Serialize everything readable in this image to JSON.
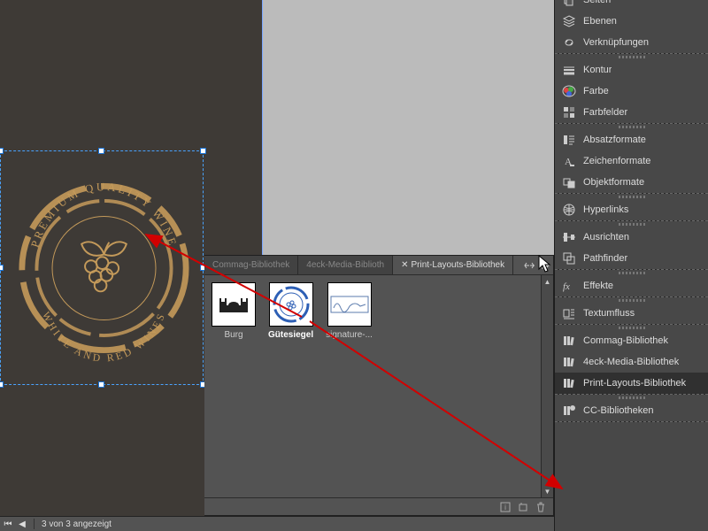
{
  "seal": {
    "top_text": "PREMIUM QUALITY WINE",
    "bottom_text": "WHITE AND RED WINES"
  },
  "library_panel": {
    "tabs": [
      {
        "label": "Commag-Bibliothek",
        "active": false
      },
      {
        "label": "4eck-Media-Biblioth",
        "active": false
      },
      {
        "label": "Print-Layouts-Bibliothek",
        "active": true
      }
    ],
    "items": [
      {
        "label": "Burg"
      },
      {
        "label": "Gütesiegel"
      },
      {
        "label": "signature-..."
      }
    ]
  },
  "status_bar": {
    "page_info": "3 von 3 angezeigt"
  },
  "dock": {
    "groups": [
      {
        "items": [
          {
            "icon": "pages",
            "label": "Seiten"
          },
          {
            "icon": "layers",
            "label": "Ebenen"
          },
          {
            "icon": "links",
            "label": "Verknüpfungen"
          }
        ]
      },
      {
        "items": [
          {
            "icon": "stroke",
            "label": "Kontur"
          },
          {
            "icon": "color",
            "label": "Farbe"
          },
          {
            "icon": "swatch",
            "label": "Farbfelder"
          }
        ]
      },
      {
        "items": [
          {
            "icon": "parastyle",
            "label": "Absatzformate"
          },
          {
            "icon": "charstyle",
            "label": "Zeichenformate"
          },
          {
            "icon": "objstyle",
            "label": "Objektformate"
          }
        ]
      },
      {
        "items": [
          {
            "icon": "hyperlink",
            "label": "Hyperlinks"
          }
        ]
      },
      {
        "items": [
          {
            "icon": "align",
            "label": "Ausrichten"
          },
          {
            "icon": "pathfinder",
            "label": "Pathfinder"
          }
        ]
      },
      {
        "items": [
          {
            "icon": "fx",
            "label": "Effekte"
          }
        ]
      },
      {
        "items": [
          {
            "icon": "textwrap",
            "label": "Textumfluss"
          }
        ]
      },
      {
        "items": [
          {
            "icon": "lib",
            "label": "Commag-Bibliothek"
          },
          {
            "icon": "lib",
            "label": "4eck-Media-Bibliothek"
          },
          {
            "icon": "lib",
            "label": "Print-Layouts-Bibliothek",
            "active": true
          }
        ]
      },
      {
        "items": [
          {
            "icon": "cclib",
            "label": "CC-Bibliotheken"
          }
        ]
      }
    ]
  }
}
